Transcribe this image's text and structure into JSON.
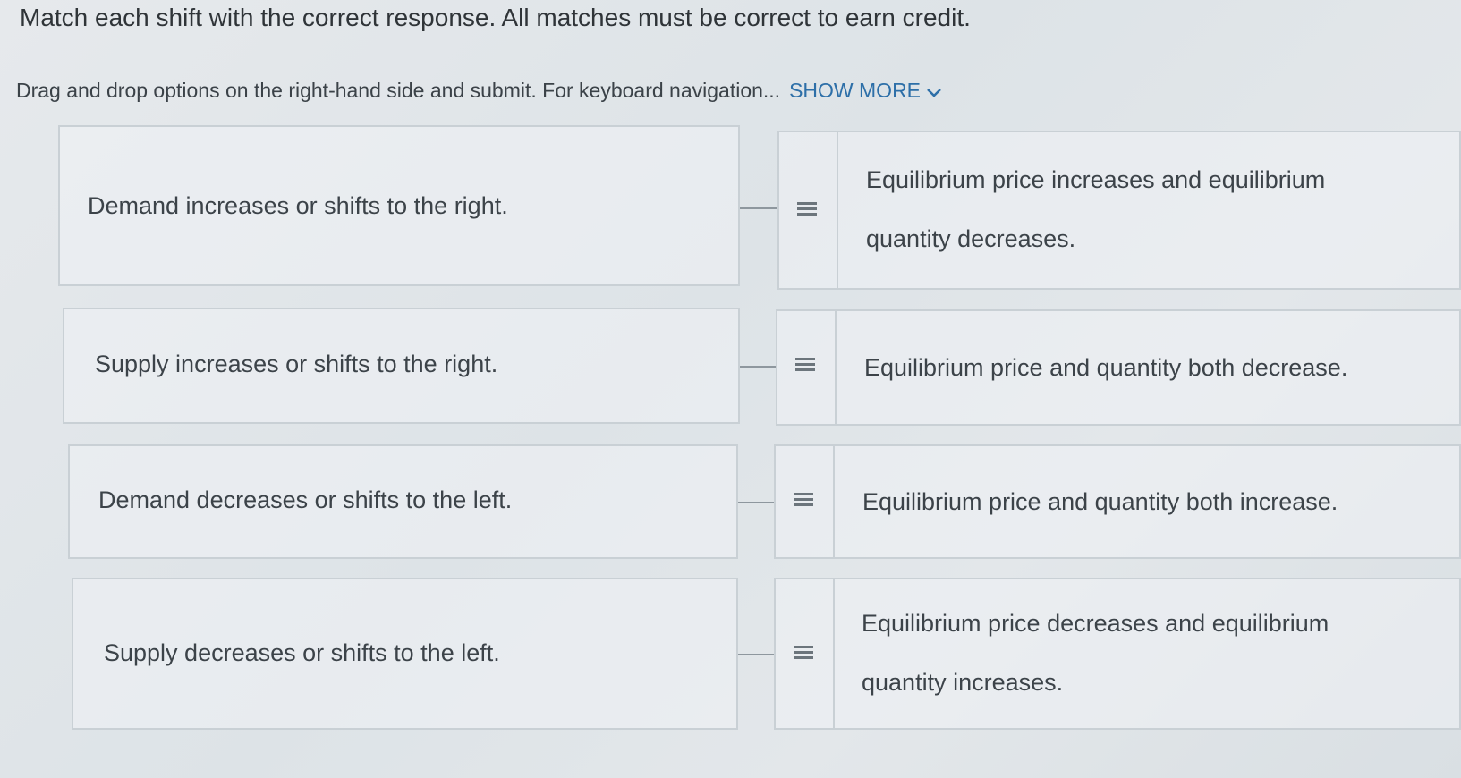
{
  "header": {
    "title": "Match each shift with the correct response. All matches must be correct to earn credit.",
    "instructions": "Drag and drop options on the right-hand side and submit. For keyboard navigation...",
    "show_more_label": "SHOW MORE"
  },
  "rows": [
    {
      "prompt": "Demand increases or shifts to the right.",
      "response_line1": "Equilibrium price increases and equilibrium",
      "response_line2": "quantity decreases."
    },
    {
      "prompt": "Supply increases or shifts to the right.",
      "response_line1": "Equilibrium price and quantity both decrease."
    },
    {
      "prompt": "Demand decreases or shifts to the left.",
      "response_line1": "Equilibrium price and quantity both increase."
    },
    {
      "prompt": "Supply decreases or shifts to the left.",
      "response_line1": "Equilibrium price decreases and equilibrium",
      "response_line2": "quantity increases."
    }
  ],
  "colors": {
    "link": "#2d6fa8",
    "border": "#c9d0d5",
    "text": "#3c4349"
  },
  "icons": {
    "drag_handle": "grip-lines-icon",
    "show_more": "chevron-down-icon"
  }
}
